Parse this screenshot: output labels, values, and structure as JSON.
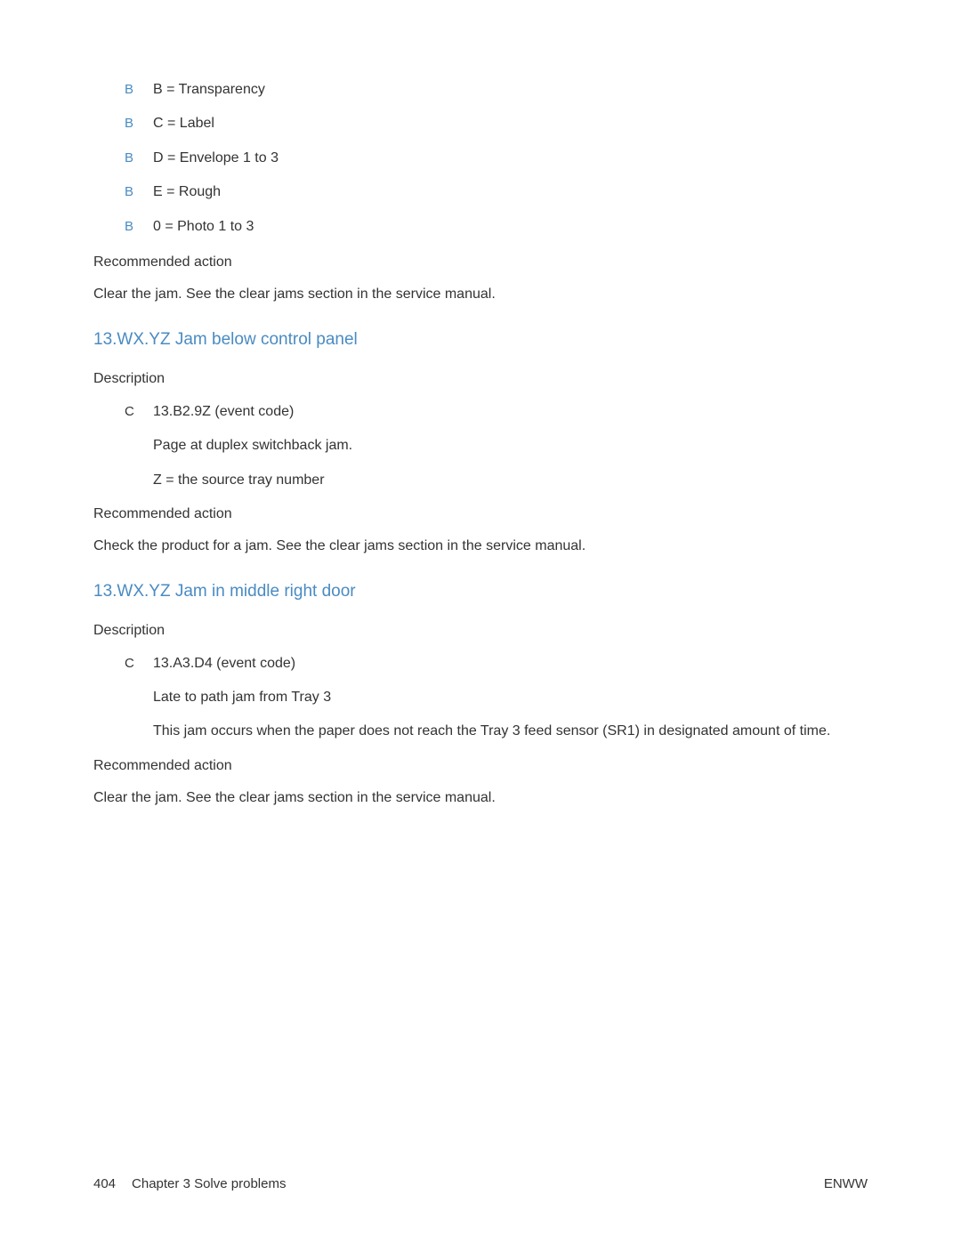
{
  "topList": [
    {
      "marker": "B",
      "text": "B = Transparency"
    },
    {
      "marker": "B",
      "text": "C = Label"
    },
    {
      "marker": "B",
      "text": "D = Envelope 1 to 3"
    },
    {
      "marker": "B",
      "text": "E = Rough"
    },
    {
      "marker": "B",
      "text": "0 = Photo 1 to 3"
    }
  ],
  "topRecommendedLabel": "Recommended action",
  "topRecommendedText": "Clear the jam. See the clear jams section in the service manual.",
  "section1": {
    "heading": "13.WX.YZ Jam below control panel",
    "descLabel": "Description",
    "eventMarker": "C",
    "eventCode": "13.B2.9Z    (event code)",
    "line1": "Page at duplex switchback jam.",
    "line2": "Z = the source tray number",
    "recLabel": "Recommended action",
    "recText": "Check the product for a jam. See the clear jams section in the service manual."
  },
  "section2": {
    "heading": "13.WX.YZ Jam in middle right door",
    "descLabel": "Description",
    "eventMarker": "C",
    "eventCode": "13.A3.D4 (event code)",
    "line1": "Late to path jam from Tray 3",
    "line2": "This jam occurs when the paper does not reach the Tray 3 feed sensor (SR1) in designated amount of time.",
    "recLabel": "Recommended action",
    "recText": "Clear the jam. See the clear jams section in the service manual."
  },
  "footer": {
    "pageNum": "404",
    "chapter": "Chapter 3   Solve problems",
    "right": "ENWW"
  }
}
